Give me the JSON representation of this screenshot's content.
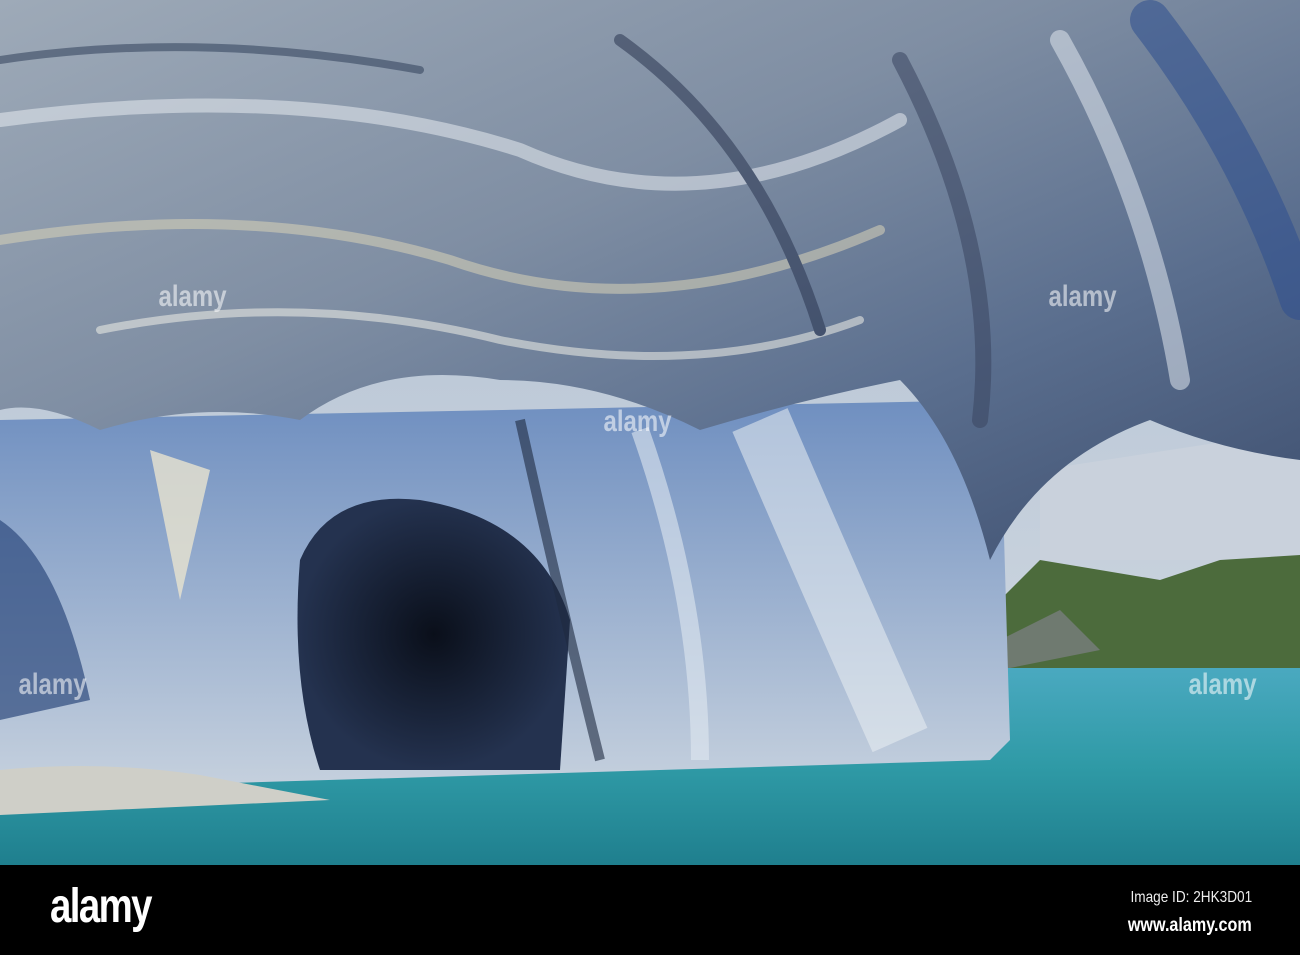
{
  "image": {
    "subject": "marble-caves",
    "colors": {
      "rock_light": "#c9d2db",
      "rock_blue": "#5a7fb0",
      "rock_dark": "#2a3550",
      "water": "#3fa3b4",
      "sky": "#b9c6d6",
      "trees": "#4a6a3a"
    }
  },
  "watermark": {
    "text": "alamy"
  },
  "banner": {
    "logo": "alamy",
    "image_id": "Image ID: 2HK3D01",
    "website": "www.alamy.com"
  }
}
